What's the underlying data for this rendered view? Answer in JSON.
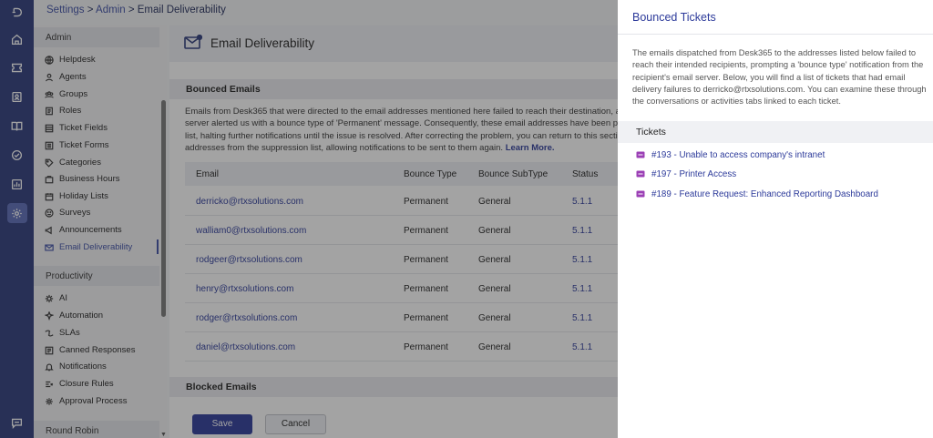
{
  "breadcrumb": {
    "settings": "Settings",
    "sep1": " > ",
    "admin": "Admin",
    "sep2": " > ",
    "current": "Email Deliverability"
  },
  "sidebar": {
    "admin_header": "Admin",
    "admin_items": [
      {
        "label": "Helpdesk",
        "icon": "globe-icon"
      },
      {
        "label": "Agents",
        "icon": "agent-icon"
      },
      {
        "label": "Groups",
        "icon": "groups-icon"
      },
      {
        "label": "Roles",
        "icon": "roles-icon"
      },
      {
        "label": "Ticket Fields",
        "icon": "ticket-fields-icon"
      },
      {
        "label": "Ticket Forms",
        "icon": "ticket-forms-icon"
      },
      {
        "label": "Categories",
        "icon": "categories-icon"
      },
      {
        "label": "Business Hours",
        "icon": "business-hours-icon"
      },
      {
        "label": "Holiday Lists",
        "icon": "holiday-lists-icon"
      },
      {
        "label": "Surveys",
        "icon": "surveys-icon"
      },
      {
        "label": "Announcements",
        "icon": "announcements-icon"
      },
      {
        "label": "Email Deliverability",
        "icon": "email-icon",
        "active": true
      }
    ],
    "productivity_header": "Productivity",
    "productivity_items": [
      {
        "label": "AI",
        "icon": "ai-icon"
      },
      {
        "label": "Automation",
        "icon": "automation-icon"
      },
      {
        "label": "SLAs",
        "icon": "sla-icon"
      },
      {
        "label": "Canned Responses",
        "icon": "canned-responses-icon"
      },
      {
        "label": "Notifications",
        "icon": "bell-icon"
      },
      {
        "label": "Closure Rules",
        "icon": "closure-rules-icon"
      },
      {
        "label": "Approval Process",
        "icon": "approval-icon"
      }
    ],
    "round_robin_header": "Round Robin"
  },
  "main": {
    "title": "Email Deliverability",
    "bounced_header": "Bounced Emails",
    "description_lines": [
      "Emails from Desk365 that were directed to the email addresses mentioned here failed to reach their destination, an",
      "server alerted us with a bounce type of 'Permanent' message. Consequently, these email addresses have been plac",
      "list, halting further notifications until the issue is resolved. After correcting the problem, you can return to this sectio",
      "addresses from the suppression list, allowing notifications to be sent to them again. "
    ],
    "learn_more": "Learn More.",
    "columns": {
      "email": "Email",
      "bounce_type": "Bounce Type",
      "bounce_subtype": "Bounce SubType",
      "status": "Status"
    },
    "rows": [
      {
        "email": "derricko@rtxsolutions.com",
        "bounce_type": "Permanent",
        "bounce_subtype": "General",
        "status": "5.1.1"
      },
      {
        "email": "walliam0@rtxsolutions.com",
        "bounce_type": "Permanent",
        "bounce_subtype": "General",
        "status": "5.1.1"
      },
      {
        "email": "rodgeer@rtxsolutions.com",
        "bounce_type": "Permanent",
        "bounce_subtype": "General",
        "status": "5.1.1"
      },
      {
        "email": "henry@rtxsolutions.com",
        "bounce_type": "Permanent",
        "bounce_subtype": "General",
        "status": "5.1.1"
      },
      {
        "email": "rodger@rtxsolutions.com",
        "bounce_type": "Permanent",
        "bounce_subtype": "General",
        "status": "5.1.1"
      },
      {
        "email": "daniel@rtxsolutions.com",
        "bounce_type": "Permanent",
        "bounce_subtype": "General",
        "status": "5.1.1"
      }
    ],
    "blocked_header": "Blocked Emails",
    "save_label": "Save",
    "cancel_label": "Cancel"
  },
  "panel": {
    "title": "Bounced Tickets",
    "description_lines": [
      "The emails dispatched from Desk365 to the addresses listed below failed to",
      "reach their intended recipients, prompting a 'bounce type' notification from the",
      "recipient's email server. Below, you will find a list of tickets that had email",
      "delivery failures to derricko@rtxsolutions.com. You can examine these through",
      "the conversations or activities tabs linked to each ticket."
    ],
    "tickets_header": "Tickets",
    "tickets": [
      {
        "label": "#193 - Unable to access company's intranet"
      },
      {
        "label": "#197 - Printer Access"
      },
      {
        "label": "#189 - Feature Request: Enhanced Reporting Dashboard"
      }
    ]
  },
  "colors": {
    "rail": "#2c3a7a",
    "accent": "#2c3a9a",
    "ticket_icon": "#9b3fb5"
  }
}
